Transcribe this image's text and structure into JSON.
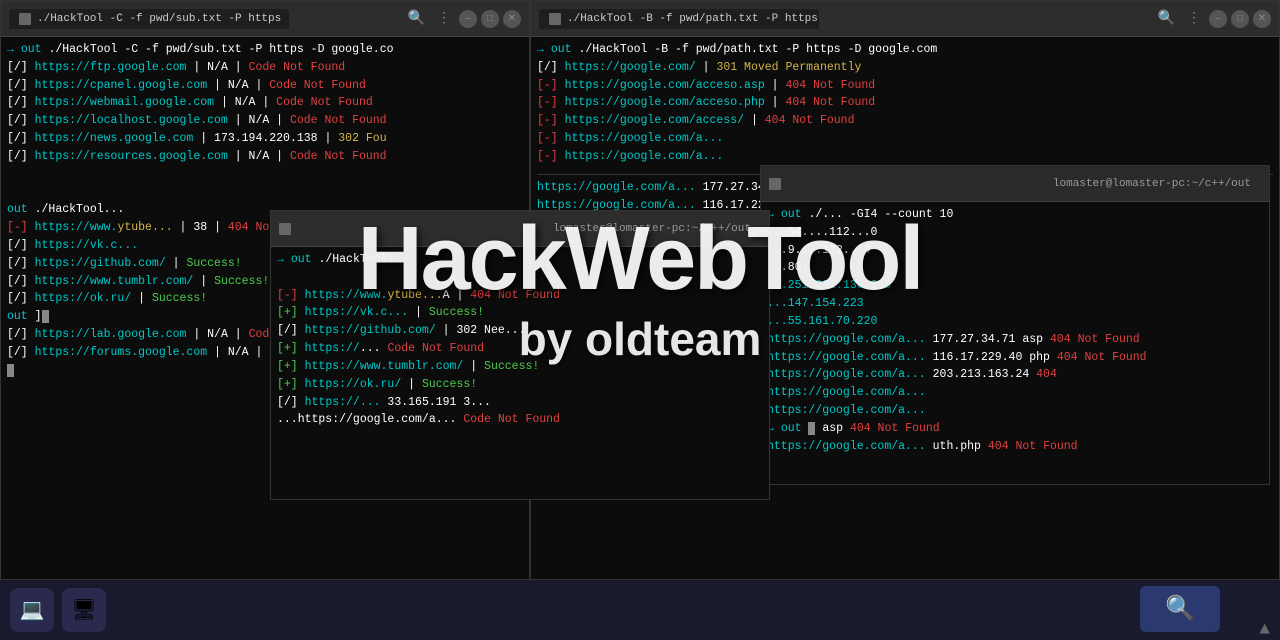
{
  "terminals": {
    "left": {
      "tab_title": "./HackTool -C -f pwd/sub.txt -P https -D google.co",
      "lines": [
        {
          "type": "cmd",
          "text": " ./HackTool -C -f pwd/sub.txt -P https -D google.co"
        },
        {
          "type": "out",
          "parts": [
            {
              "text": "[/] ",
              "color": "white"
            },
            {
              "text": "https://ftp.google.com",
              "color": "cyan"
            },
            {
              "text": " | N/A | ",
              "color": "white"
            },
            {
              "text": "Code Not Found",
              "color": "red"
            }
          ]
        },
        {
          "type": "out",
          "parts": [
            {
              "text": "[/] ",
              "color": "white"
            },
            {
              "text": "https://cpanel.google.com",
              "color": "cyan"
            },
            {
              "text": " | N/A | ",
              "color": "white"
            },
            {
              "text": "Code Not Found",
              "color": "red"
            }
          ]
        },
        {
          "type": "out",
          "parts": [
            {
              "text": "[/] ",
              "color": "white"
            },
            {
              "text": "https://webmail.google.com",
              "color": "cyan"
            },
            {
              "text": " | N/A | ",
              "color": "white"
            },
            {
              "text": "Code Not Found",
              "color": "red"
            }
          ]
        },
        {
          "type": "out",
          "parts": [
            {
              "text": "[/] ",
              "color": "white"
            },
            {
              "text": "https://localhost.google.com",
              "color": "cyan"
            },
            {
              "text": " | N/A | ",
              "color": "white"
            },
            {
              "text": "Code Not Found",
              "color": "red"
            }
          ]
        },
        {
          "type": "out",
          "parts": [
            {
              "text": "[/] ",
              "color": "white"
            },
            {
              "text": "https://news.google.com",
              "color": "cyan"
            },
            {
              "text": " | 173.194.220.138 | ",
              "color": "white"
            },
            {
              "text": "302 Fou",
              "color": "yellow"
            }
          ]
        },
        {
          "type": "out",
          "parts": [
            {
              "text": "[/] ",
              "color": "white"
            },
            {
              "text": "https://resources.google.com",
              "color": "cyan"
            },
            {
              "text": " | N/A | ",
              "color": "white"
            },
            {
              "text": "Code Not Found",
              "color": "red"
            }
          ]
        },
        {
          "type": "blank"
        },
        {
          "type": "blank"
        },
        {
          "type": "out2",
          "prefix": "[/] ",
          "url": "https://www.",
          "extra": "ytube..."
        },
        {
          "type": "out2",
          "prefix": "[-] ",
          "url": "https://vk.c...",
          "extra": ""
        },
        {
          "type": "out2",
          "prefix": "[/] ",
          "url": "https://github.com/",
          "extra": "| Success!"
        },
        {
          "type": "out2",
          "prefix": "[/] ",
          "url": "https://www.tumblr.com/",
          "extra": "| Success!"
        },
        {
          "type": "out2",
          "prefix": "[/] ",
          "url": "https://ok.ru/",
          "extra": "| Success!"
        },
        {
          "type": "out",
          "parts": [
            {
              "text": "   out ",
              "color": "cyan"
            },
            {
              "text": "] ",
              "color": "white"
            }
          ]
        },
        {
          "type": "out",
          "parts": [
            {
              "text": "[/] ",
              "color": "white"
            },
            {
              "text": "https://lab.google.com",
              "color": "cyan"
            },
            {
              "text": " | N/A | ",
              "color": "white"
            },
            {
              "text": "Code Not Found",
              "color": "red"
            }
          ]
        },
        {
          "type": "out",
          "parts": [
            {
              "text": "[/] ",
              "color": "white"
            },
            {
              "text": "https://forums.google.com",
              "color": "cyan"
            },
            {
              "text": " | N/A | ",
              "color": "white"
            },
            {
              "text": "Code Not Found",
              "color": "red"
            }
          ]
        },
        {
          "type": "prompt"
        }
      ]
    },
    "right": {
      "tab_title": "./HackTool -B -f pwd/path.txt -P https -D google.com",
      "lines": [
        {
          "type": "cmd",
          "text": " ./HackTool -B -f pwd/path.txt -P https -D google.com"
        },
        {
          "type": "out",
          "parts": [
            {
              "text": "[/] ",
              "color": "white"
            },
            {
              "text": "https://google.com/",
              "color": "cyan"
            },
            {
              "text": " | ",
              "color": "white"
            },
            {
              "text": "301 Moved Permanently",
              "color": "yellow"
            }
          ]
        },
        {
          "type": "out",
          "parts": [
            {
              "text": "[-] ",
              "color": "white"
            },
            {
              "text": "https://google.com/acceso.asp",
              "color": "cyan"
            },
            {
              "text": " | ",
              "color": "white"
            },
            {
              "text": "404 Not Found",
              "color": "red"
            }
          ]
        },
        {
          "type": "out",
          "parts": [
            {
              "text": "[-] ",
              "color": "white"
            },
            {
              "text": "https://google.com/acceso.php",
              "color": "cyan"
            },
            {
              "text": " | ",
              "color": "white"
            },
            {
              "text": "404 Not Found",
              "color": "red"
            }
          ]
        },
        {
          "type": "out",
          "parts": [
            {
              "text": "[-] ",
              "color": "white"
            },
            {
              "text": "https://google.com/access/",
              "color": "cyan"
            },
            {
              "text": " | ",
              "color": "white"
            },
            {
              "text": "404 Not Found",
              "color": "red"
            }
          ]
        },
        {
          "type": "partial",
          "text": "[-] https://google.com/a..."
        },
        {
          "type": "partial",
          "text": "[-] https://google.com/a..."
        }
      ]
    },
    "bottom_right": {
      "title_info": "lomaster@lomaster-pc:~/c++/out",
      "lines": [
        {
          "type": "cmd2",
          "text": " ./...  -GI4 --count 10"
        },
        {
          "type": "ip",
          "url": "...54.",
          "ip": "...112...0"
        },
        {
          "type": "ip",
          "url": "...9.",
          "ip": "...172...4"
        },
        {
          "type": "ip",
          "url": "...",
          "ip": "...80."
        },
        {
          "type": "ip2",
          "url": "...251.231.130.248"
        },
        {
          "type": "ip2",
          "url": "...147.154.223"
        },
        {
          "type": "ip2",
          "url": "...55.161.70.220"
        },
        {
          "type": "ip3",
          "url": "https://google.com/a...",
          "ip": "177.27.34.71",
          "ext": "asp",
          "status": "404 Not Found"
        },
        {
          "type": "ip3",
          "url": "https://google.com/a...",
          "ip": "116.17.229.40",
          "ext": "php",
          "status": "404 Not Found"
        },
        {
          "type": "ip4",
          "url": "https://google.com/a...",
          "ip": "203.213.163.24",
          "status": "404"
        },
        {
          "type": "partial2",
          "url": "https://google.com/a..."
        },
        {
          "type": "partial2",
          "url": "https://google.com/a..."
        },
        {
          "type": "prompt2",
          "text": "out [_] asp"
        },
        {
          "type": "partial2",
          "url": "https://google.com/a... uth.php"
        },
        {
          "type": "status2",
          "text": "404 Not Found"
        }
      ]
    },
    "middle": {
      "title_info": "lomaster@lomaster-pc:~/c++/out",
      "lines": [
        {
          "type": "cmd2",
          "text": " ./HackTool ..."
        },
        {
          "type": "blank"
        },
        {
          "type": "ip_entry",
          "prefix": "[-]",
          "url": "https://www.",
          "extra": "ytube...A",
          "status": "404 Not Found"
        },
        {
          "type": "ip_entry2",
          "prefix": "[+]",
          "url": "https://vk.c...",
          "status": "Success!"
        },
        {
          "type": "ip_entry2",
          "prefix": "[/]",
          "url": "https://github.com/",
          "status": "302 Nee..."
        },
        {
          "type": "ip_entry3",
          "prefix": "[+]",
          "url": "https://",
          "extra": "...Code Not Found"
        },
        {
          "type": "ip_entry2",
          "prefix": "[+]",
          "url": "https://www.tumblr.com/",
          "status": "Success!"
        },
        {
          "type": "ip_entry2",
          "prefix": "[+]",
          "url": "https://ok.ru/",
          "status": "Success!"
        },
        {
          "type": "ip_entry3",
          "prefix": "[/]",
          "url": "https://...",
          "extra": "33.165.191 3..."
        },
        {
          "type": "partial3",
          "text": "...https://google.com/a... Code Not Found"
        }
      ]
    }
  },
  "watermark": {
    "title": "HackWebTool",
    "subtitle": "by oldteam"
  },
  "taskbar": {
    "search_icon": "🔍",
    "arrow_icon": "▲"
  }
}
